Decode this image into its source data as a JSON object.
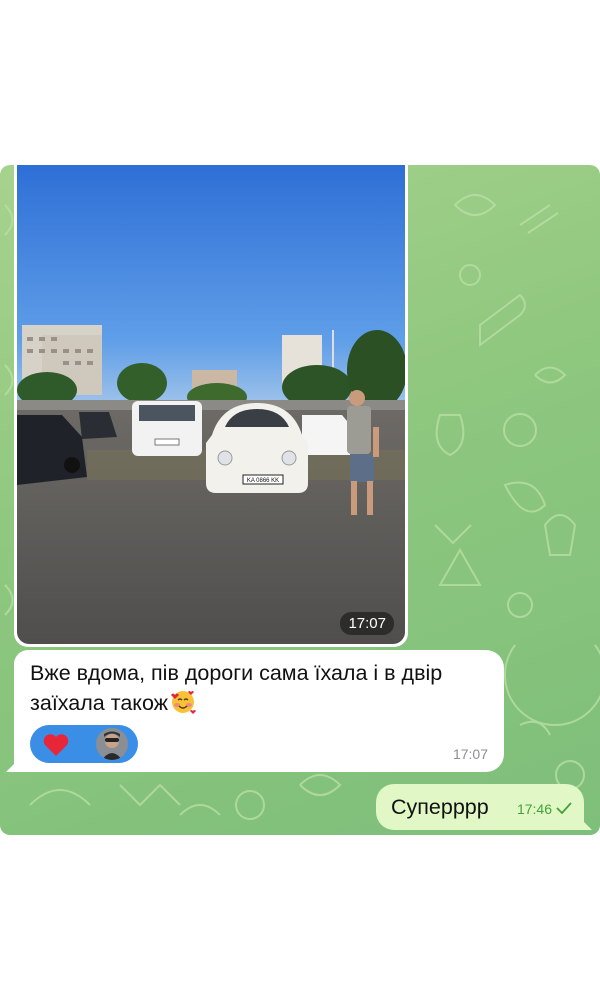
{
  "messages": {
    "photo": {
      "time": "17:07",
      "plate": "KA 0866 KK"
    },
    "incoming_text": {
      "text": "Вже вдома, пів дороги сама їхала і в двір заїхала також",
      "emoji": "smiling-face-with-hearts",
      "time": "17:07",
      "reactions": [
        "red-heart",
        "user-avatar"
      ]
    },
    "outgoing_text": {
      "text": "Суперррр",
      "time": "17:46",
      "status": "delivered-check"
    }
  },
  "colors": {
    "outgoing_bubble": "#e1f8c6",
    "incoming_bubble": "#ffffff",
    "reaction_badge": "#3a8ee6",
    "wallpaper": "#8ec77e",
    "out_time": "#44a13a"
  }
}
